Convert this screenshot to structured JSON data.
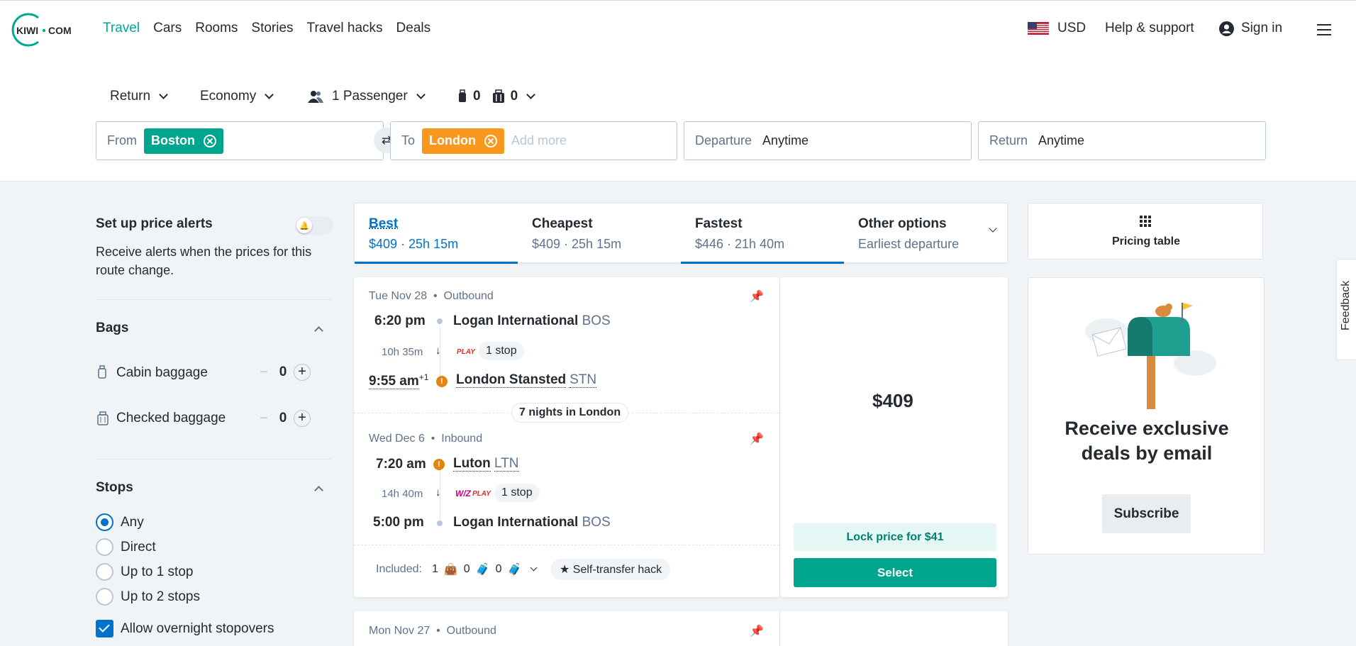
{
  "header": {
    "logo_text": "KIWI · COM",
    "nav": [
      "Travel",
      "Cars",
      "Rooms",
      "Stories",
      "Travel hacks",
      "Deals"
    ],
    "currency": "USD",
    "help": "Help & support",
    "signin": "Sign in"
  },
  "search": {
    "trip_type": "Return",
    "cabin": "Economy",
    "passengers": "1 Passenger",
    "cabin_bags": "0",
    "checked_bags": "0",
    "from_label": "From",
    "from_value": "Boston",
    "to_label": "To",
    "to_value": "London",
    "to_placeholder": "Add more",
    "departure_label": "Departure",
    "departure_value": "Anytime",
    "return_label": "Return",
    "return_value": "Anytime"
  },
  "sidebar": {
    "alerts_title": "Set up price alerts",
    "alerts_text_1": "Receive alerts when the prices for this",
    "alerts_text_2": "route change.",
    "bags_title": "Bags",
    "cabin_label": "Cabin baggage",
    "cabin_value": "0",
    "checked_label": "Checked baggage",
    "checked_value": "0",
    "stops_title": "Stops",
    "stops": [
      "Any",
      "Direct",
      "Up to 1 stop",
      "Up to 2 stops"
    ],
    "overnight": "Allow overnight stopovers"
  },
  "sort": {
    "tabs": [
      {
        "title": "Best",
        "sub": "$409 · 25h 15m"
      },
      {
        "title": "Cheapest",
        "sub": "$409 · 25h 15m"
      },
      {
        "title": "Fastest",
        "sub": "$446 · 21h 40m"
      },
      {
        "title": "Other options",
        "sub": "Earliest departure"
      }
    ]
  },
  "result1": {
    "out_date": "Tue Nov 28",
    "out_dir": "Outbound",
    "out_dep_time": "6:20 pm",
    "out_dep_place": "Logan International",
    "out_dep_code": "BOS",
    "out_duration": "10h 35m",
    "out_airline": "PLAY",
    "out_stops": "1 stop",
    "out_arr_time": "9:55 am",
    "out_arr_sup": "+1",
    "out_arr_place": "London Stansted",
    "out_arr_code": "STN",
    "nights": "7 nights in London",
    "in_date": "Wed Dec 6",
    "in_dir": "Inbound",
    "in_dep_time": "7:20 am",
    "in_dep_place": "Luton",
    "in_dep_code": "LTN",
    "in_duration": "14h 40m",
    "in_airline_1": "W/Z",
    "in_airline_2": "PLAY",
    "in_stops": "1 stop",
    "in_arr_time": "5:00 pm",
    "in_arr_place": "Logan International",
    "in_arr_code": "BOS",
    "included_label": "Included:",
    "inc_personal": "1",
    "inc_cabin": "0",
    "inc_checked": "0",
    "hack": "Self-transfer hack",
    "price": "$409",
    "lock": "Lock price for $41",
    "select": "Select"
  },
  "result2": {
    "out_date": "Mon Nov 27",
    "out_dir": "Outbound"
  },
  "right": {
    "pricing_table": "Pricing table",
    "promo_line1": "Receive exclusive",
    "promo_line2": "deals by email",
    "subscribe": "Subscribe",
    "feedback": "Feedback"
  },
  "colors": {
    "brand": "#00a991",
    "from_chip": "#00a58e",
    "to_chip": "#f9971e",
    "accent_blue": "#0172cb"
  }
}
